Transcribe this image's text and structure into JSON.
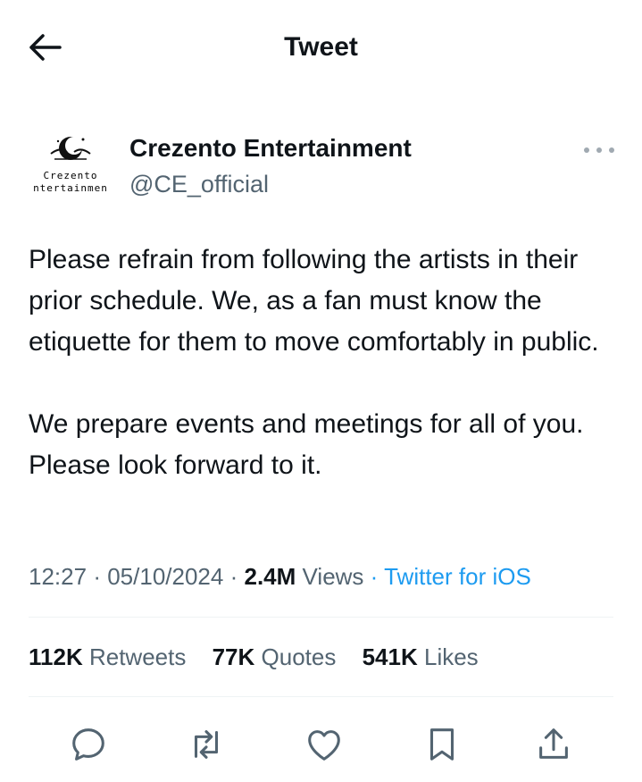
{
  "header": {
    "title": "Tweet",
    "back_icon": "arrow-left-icon"
  },
  "author": {
    "display_name": "Crezento Entertainment",
    "handle": "@CE_official",
    "avatar_logo_line1": "Crezento",
    "avatar_logo_line2": "ntertainmen"
  },
  "tweet": {
    "text": "Please refrain from following the artists in their prior schedule. We, as a fan must know the etiquette for them to move comfortably in public.\n\nWe prepare events and meetings for all of you. Please look forward to it.",
    "time": "12:27",
    "date": "05/10/2024",
    "views_count": "2.4M",
    "views_label": "Views",
    "source": "Twitter for iOS",
    "separator": "·"
  },
  "stats": [
    {
      "count": "112K",
      "label": "Retweets"
    },
    {
      "count": "77K",
      "label": "Quotes"
    },
    {
      "count": "541K",
      "label": "Likes"
    }
  ],
  "actions": [
    "reply-icon",
    "retweet-icon",
    "like-icon",
    "bookmark-icon",
    "share-icon"
  ],
  "colors": {
    "text": "#0f1419",
    "secondary": "#536471",
    "link": "#1d9bf0",
    "divider": "#eff3f4"
  }
}
